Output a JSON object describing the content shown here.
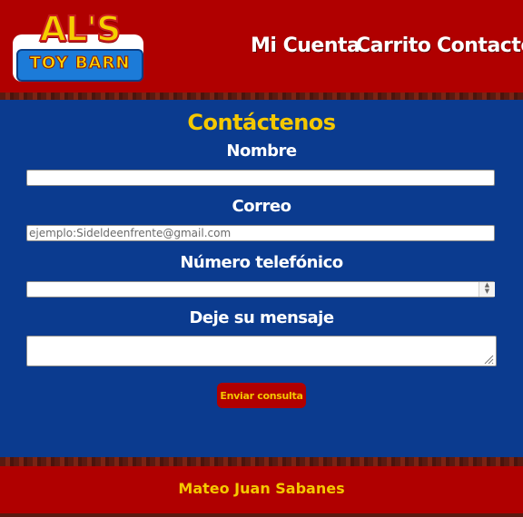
{
  "header": {
    "logo_top": "AL'S",
    "logo_bottom": "TOY BARN",
    "nav": [
      {
        "label": "Mi Cuenta"
      },
      {
        "label": "Carrito"
      },
      {
        "label": "Contacto"
      }
    ]
  },
  "form": {
    "title": "Contáctenos",
    "name_label": "Nombre",
    "name_value": "",
    "email_label": "Correo",
    "email_placeholder": "ejemplo:Sideldeenfrente@gmail.com",
    "phone_label": "Número telefónico",
    "phone_value": "",
    "message_label": "Deje su mensaje",
    "message_value": "",
    "submit_label": "Enviar consulta"
  },
  "footer": {
    "text": "Mateo Juan Sabanes"
  },
  "colors": {
    "header_red": "#b00000",
    "body_blue": "#0b3b8f",
    "accent_yellow": "#f5c800"
  }
}
